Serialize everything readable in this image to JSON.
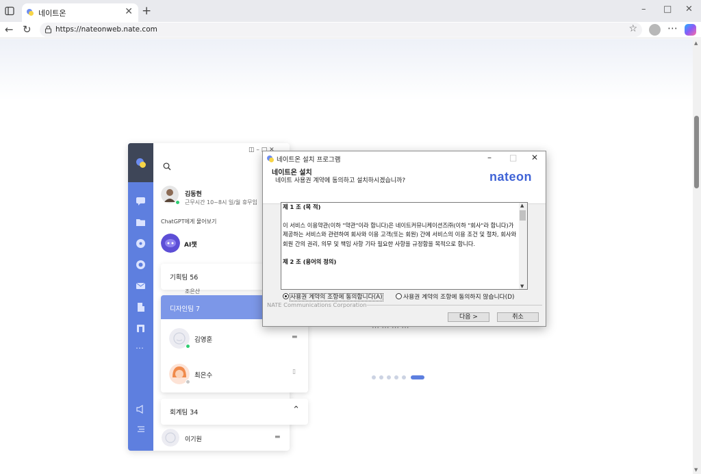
{
  "browser": {
    "tab_title": "네이트온",
    "url": "https://nateonweb.nate.com",
    "new_tab_label": "+",
    "tab_close_label": "✕"
  },
  "app_preview": {
    "me": {
      "name": "김동현",
      "status": "근무시간 10~8시 일/월 휴무임"
    },
    "chatgpt_label": "ChatGPT에게 물어보기",
    "ai_name": "AI챗",
    "groups": [
      {
        "label": "기획팀 56"
      },
      {
        "label": "디자인팀 7"
      },
      {
        "label": "회계팀 34"
      }
    ],
    "peek_name": "조은산",
    "members": [
      {
        "name": "김영훈",
        "status_color": "#2ecc71"
      },
      {
        "name": "최은수",
        "status_color": "#c7c7c7"
      },
      {
        "name": "이기원"
      }
    ]
  },
  "background_text": "… … … …",
  "installer": {
    "title": "네이트온 설치 프로그램",
    "heading": "네이트온 설치",
    "subheading": "네이트 사용권 계약에 동의하고 설치하시겠습니까?",
    "brand": "nateon",
    "license": {
      "article1_title": "제 1 조 (목 적)",
      "article1_body": "이 서비스 이용약관(이하 \"약관\"이라 합니다)은 네이트커뮤니케이션즈㈜(이하 \"회사\"라 합니다)가 제공하는 서비스와 관련하여 회사와 이용 고객(또는 회원) 간에 서비스의 이용 조건 및 절차, 회사와 회원 간의 권리, 의무 및 책임 사항 기타 필요한 사항을 규정함을 목적으로 합니다.",
      "article2_title": "제 2 조 (용어의 정의)"
    },
    "agree_label": "사용권 계약의 조항에 동의합니다(A)",
    "disagree_label": "사용권 계약의 조항에 동의하지 않습니다(D)",
    "agree_selected": true,
    "company": "NATE Communications Corporation",
    "next_button": "다음 >",
    "cancel_button": "취소"
  },
  "colors": {
    "brand_blue": "#3f63d6",
    "sidebar_blue": "#5e7fdf",
    "sidebar_dark": "#3e4658"
  }
}
